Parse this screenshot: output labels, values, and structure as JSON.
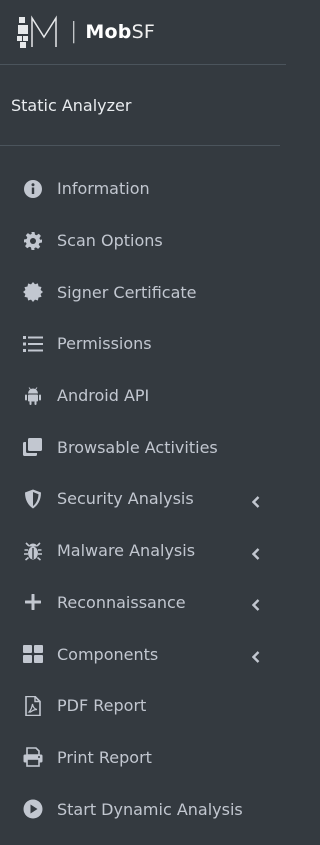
{
  "brand": {
    "separator": "|",
    "name_bold": "Mob",
    "name_light": "SF"
  },
  "section": {
    "title": "Static Analyzer"
  },
  "nav": {
    "items": [
      {
        "label": "Information",
        "icon": "info-circle-icon"
      },
      {
        "label": "Scan Options",
        "icon": "gear-icon"
      },
      {
        "label": "Signer Certificate",
        "icon": "certificate-icon"
      },
      {
        "label": "Permissions",
        "icon": "list-icon"
      },
      {
        "label": "Android API",
        "icon": "android-icon"
      },
      {
        "label": "Browsable Activities",
        "icon": "clone-icon"
      },
      {
        "label": "Security Analysis",
        "icon": "shield-icon",
        "has_submenu": true
      },
      {
        "label": "Malware Analysis",
        "icon": "bug-icon",
        "has_submenu": true
      },
      {
        "label": "Reconnaissance",
        "icon": "plus-icon",
        "has_submenu": true
      },
      {
        "label": "Components",
        "icon": "th-large-icon",
        "has_submenu": true
      },
      {
        "label": "PDF Report",
        "icon": "file-pdf-icon"
      },
      {
        "label": "Print Report",
        "icon": "print-icon"
      },
      {
        "label": "Start Dynamic Analysis",
        "icon": "play-circle-icon"
      }
    ]
  },
  "colors": {
    "sidebar_bg": "#343a40",
    "text": "#c2c7d0",
    "divider": "#4b545c"
  }
}
